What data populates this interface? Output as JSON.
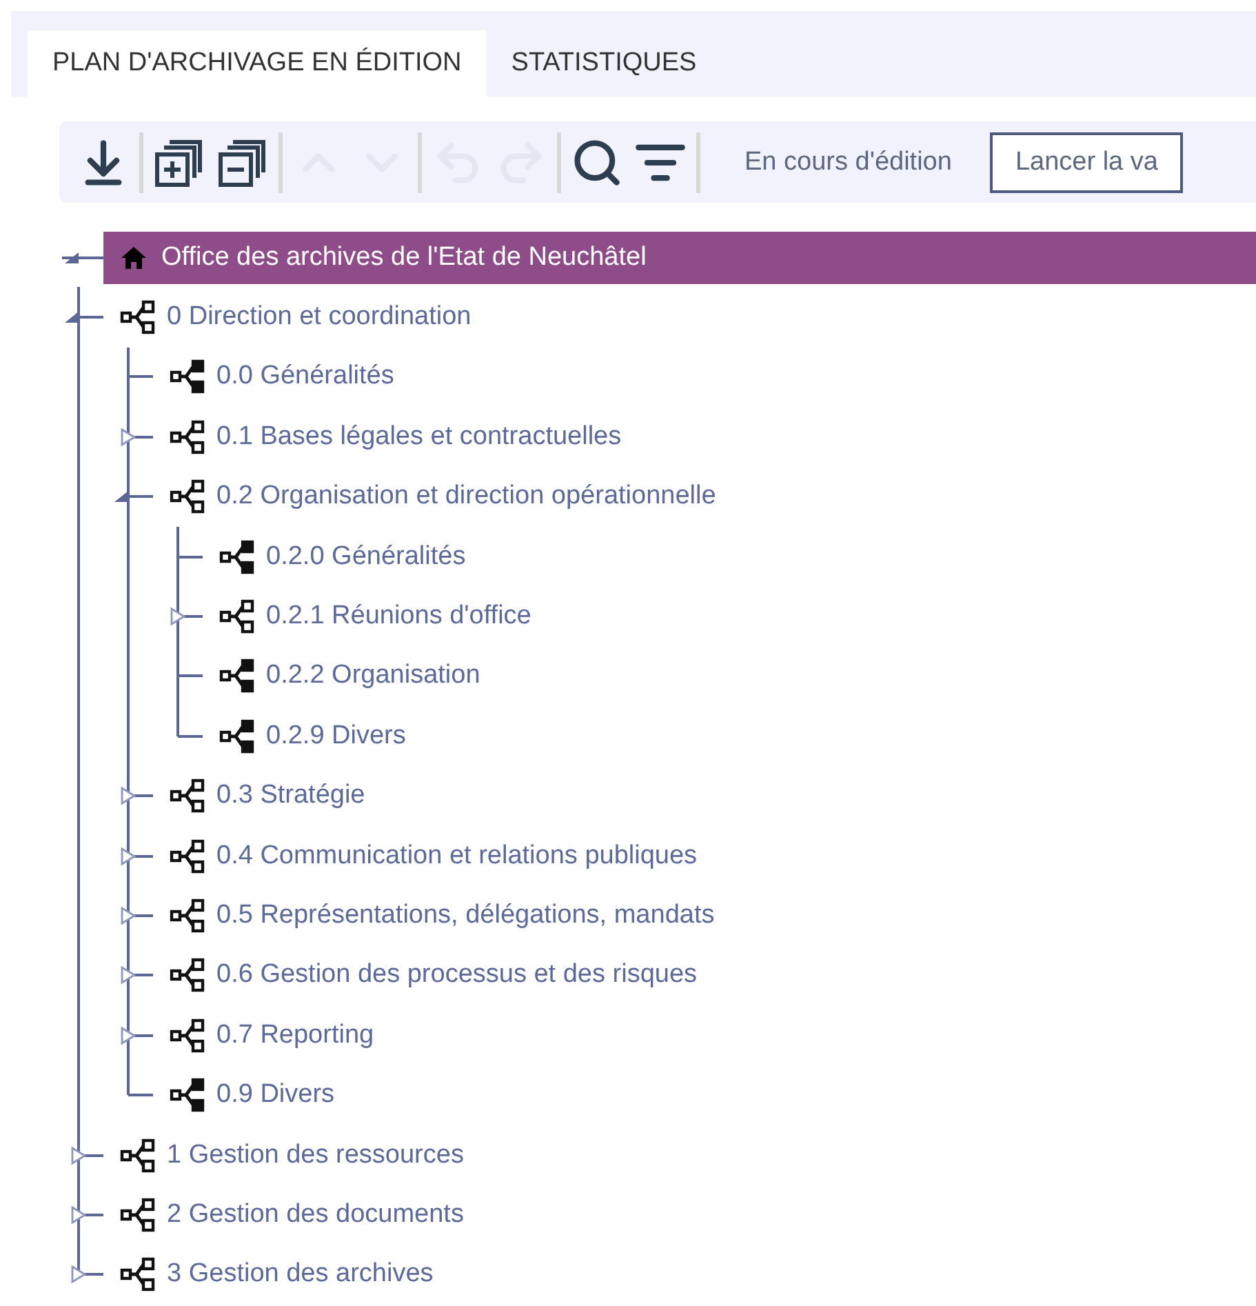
{
  "tabs": [
    {
      "label": "PLAN D'ARCHIVAGE EN ÉDITION",
      "selected": true
    },
    {
      "label": "STATISTIQUES",
      "selected": false
    }
  ],
  "toolbar": {
    "groups": [
      [
        {
          "kind": "download",
          "disabled": false
        }
      ],
      [
        {
          "kind": "expand-all",
          "disabled": false
        },
        {
          "kind": "collapse-all",
          "disabled": false
        }
      ],
      [
        {
          "kind": "up",
          "disabled": true
        },
        {
          "kind": "down",
          "disabled": true
        }
      ],
      [
        {
          "kind": "undo",
          "disabled": true
        },
        {
          "kind": "redo",
          "disabled": true
        }
      ],
      [
        {
          "kind": "search",
          "disabled": false
        },
        {
          "kind": "filter",
          "disabled": false
        }
      ]
    ],
    "status": "En cours d'édition",
    "action_button": "Lancer la va"
  },
  "tree": {
    "label": "Office des archives de l'Etat de Neuchâtel",
    "kind": "root",
    "expanded": true,
    "selected": true,
    "children": [
      {
        "label": "0 Direction et coordination",
        "kind": "branch",
        "expanded": true,
        "children": [
          {
            "label": "0.0 Généralités",
            "kind": "leaf"
          },
          {
            "label": "0.1 Bases légales et contractuelles",
            "kind": "branch",
            "expanded": false
          },
          {
            "label": "0.2 Organisation et direction opérationnelle",
            "kind": "branch",
            "expanded": true,
            "children": [
              {
                "label": "0.2.0 Généralités",
                "kind": "leaf"
              },
              {
                "label": "0.2.1 Réunions d'office",
                "kind": "branch",
                "expanded": false
              },
              {
                "label": "0.2.2 Organisation",
                "kind": "leaf"
              },
              {
                "label": "0.2.9 Divers",
                "kind": "leaf"
              }
            ]
          },
          {
            "label": "0.3 Stratégie",
            "kind": "branch",
            "expanded": false
          },
          {
            "label": "0.4 Communication et relations publiques",
            "kind": "branch",
            "expanded": false
          },
          {
            "label": "0.5 Représentations, délégations, mandats",
            "kind": "branch",
            "expanded": false
          },
          {
            "label": "0.6 Gestion des processus et des risques",
            "kind": "branch",
            "expanded": false
          },
          {
            "label": "0.7 Reporting",
            "kind": "branch",
            "expanded": false
          },
          {
            "label": "0.9 Divers",
            "kind": "leaf"
          }
        ]
      },
      {
        "label": "1 Gestion des ressources",
        "kind": "branch",
        "expanded": false
      },
      {
        "label": "2 Gestion des documents",
        "kind": "branch",
        "expanded": false
      },
      {
        "label": "3 Gestion des archives",
        "kind": "branch",
        "expanded": false
      }
    ]
  }
}
